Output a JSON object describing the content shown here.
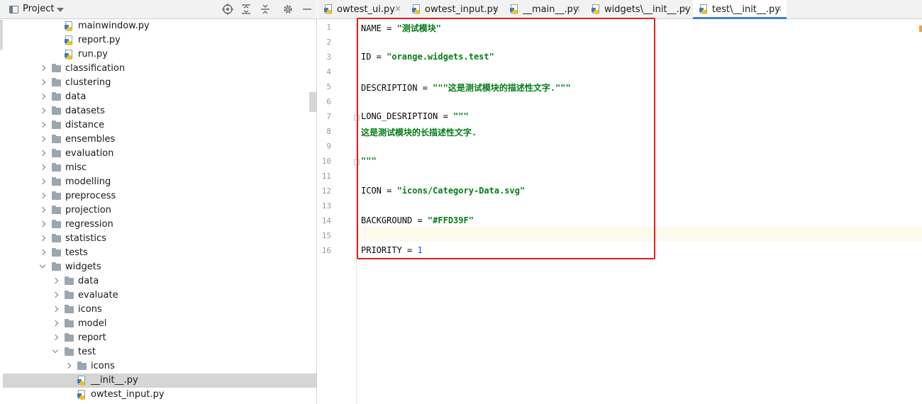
{
  "project_panel": {
    "title": "Project",
    "tree": [
      {
        "label": "mainwindow.py",
        "kind": "file",
        "depth": 5,
        "state": "none"
      },
      {
        "label": "report.py",
        "kind": "file",
        "depth": 5,
        "state": "none"
      },
      {
        "label": "run.py",
        "kind": "file",
        "depth": 5,
        "state": "none"
      },
      {
        "label": "classification",
        "kind": "folder",
        "depth": 4,
        "state": "collapsed"
      },
      {
        "label": "clustering",
        "kind": "folder",
        "depth": 4,
        "state": "collapsed"
      },
      {
        "label": "data",
        "kind": "folder",
        "depth": 4,
        "state": "collapsed"
      },
      {
        "label": "datasets",
        "kind": "folder",
        "depth": 4,
        "state": "collapsed"
      },
      {
        "label": "distance",
        "kind": "folder",
        "depth": 4,
        "state": "collapsed"
      },
      {
        "label": "ensembles",
        "kind": "folder",
        "depth": 4,
        "state": "collapsed"
      },
      {
        "label": "evaluation",
        "kind": "folder",
        "depth": 4,
        "state": "collapsed"
      },
      {
        "label": "misc",
        "kind": "folder",
        "depth": 4,
        "state": "collapsed"
      },
      {
        "label": "modelling",
        "kind": "folder",
        "depth": 4,
        "state": "collapsed"
      },
      {
        "label": "preprocess",
        "kind": "folder",
        "depth": 4,
        "state": "collapsed"
      },
      {
        "label": "projection",
        "kind": "folder",
        "depth": 4,
        "state": "collapsed"
      },
      {
        "label": "regression",
        "kind": "folder",
        "depth": 4,
        "state": "collapsed"
      },
      {
        "label": "statistics",
        "kind": "folder",
        "depth": 4,
        "state": "collapsed"
      },
      {
        "label": "tests",
        "kind": "folder",
        "depth": 4,
        "state": "collapsed"
      },
      {
        "label": "widgets",
        "kind": "folder",
        "depth": 4,
        "state": "expanded"
      },
      {
        "label": "data",
        "kind": "folder",
        "depth": 5,
        "state": "collapsed"
      },
      {
        "label": "evaluate",
        "kind": "folder",
        "depth": 5,
        "state": "collapsed"
      },
      {
        "label": "icons",
        "kind": "folder",
        "depth": 5,
        "state": "collapsed"
      },
      {
        "label": "model",
        "kind": "folder",
        "depth": 5,
        "state": "collapsed"
      },
      {
        "label": "report",
        "kind": "folder",
        "depth": 5,
        "state": "collapsed"
      },
      {
        "label": "test",
        "kind": "folder",
        "depth": 5,
        "state": "expanded"
      },
      {
        "label": "icons",
        "kind": "folder",
        "depth": 6,
        "state": "collapsed"
      },
      {
        "label": "__init__.py",
        "kind": "file",
        "depth": 6,
        "state": "none",
        "selected": true
      },
      {
        "label": "owtest_input.py",
        "kind": "file",
        "depth": 6,
        "state": "none"
      }
    ]
  },
  "tabs": [
    {
      "label": "owtest_ui.py",
      "active": false
    },
    {
      "label": "owtest_input.py",
      "active": false
    },
    {
      "label": "__main__.py",
      "active": false
    },
    {
      "label": "widgets\\__init__.py",
      "active": false
    },
    {
      "label": "test\\__init__.py",
      "active": true
    }
  ],
  "tab_close_glyph": "×",
  "editor": {
    "lines": [
      {
        "n": "1",
        "parts": [
          {
            "t": "NAME = ",
            "c": ""
          },
          {
            "t": "\"测试模块\"",
            "c": "str"
          }
        ]
      },
      {
        "n": "2",
        "parts": []
      },
      {
        "n": "3",
        "parts": [
          {
            "t": "ID = ",
            "c": ""
          },
          {
            "t": "\"orange.widgets.test\"",
            "c": "str"
          }
        ]
      },
      {
        "n": "4",
        "parts": []
      },
      {
        "n": "5",
        "parts": [
          {
            "t": "DESCRIPTION = ",
            "c": ""
          },
          {
            "t": "\"\"\"这是测试模块的描述性文字.\"\"\"",
            "c": "str"
          }
        ]
      },
      {
        "n": "6",
        "parts": []
      },
      {
        "n": "7",
        "parts": [
          {
            "t": "LONG_DESRIPTION = ",
            "c": ""
          },
          {
            "t": "\"\"\"",
            "c": "str"
          }
        ]
      },
      {
        "n": "8",
        "parts": [
          {
            "t": "这是测试模块的长描述性文字.",
            "c": "str"
          }
        ]
      },
      {
        "n": "9",
        "parts": []
      },
      {
        "n": "10",
        "parts": [
          {
            "t": "\"\"\"",
            "c": "str"
          }
        ]
      },
      {
        "n": "11",
        "parts": []
      },
      {
        "n": "12",
        "parts": [
          {
            "t": "ICON = ",
            "c": ""
          },
          {
            "t": "\"icons/Category-Data.svg\"",
            "c": "str"
          }
        ]
      },
      {
        "n": "13",
        "parts": []
      },
      {
        "n": "14",
        "parts": [
          {
            "t": "BACKGROUND = ",
            "c": ""
          },
          {
            "t": "\"#FFD39F\"",
            "c": "str"
          }
        ]
      },
      {
        "n": "15",
        "parts": []
      },
      {
        "n": "16",
        "parts": [
          {
            "t": "PRIORITY = ",
            "c": ""
          },
          {
            "t": "1",
            "c": "num"
          }
        ]
      }
    ],
    "current_line": "15"
  },
  "colors": {
    "string": "#067d17",
    "number": "#1750eb",
    "highlight_box": "#e02020",
    "active_tab_underline": "#4083c9"
  }
}
